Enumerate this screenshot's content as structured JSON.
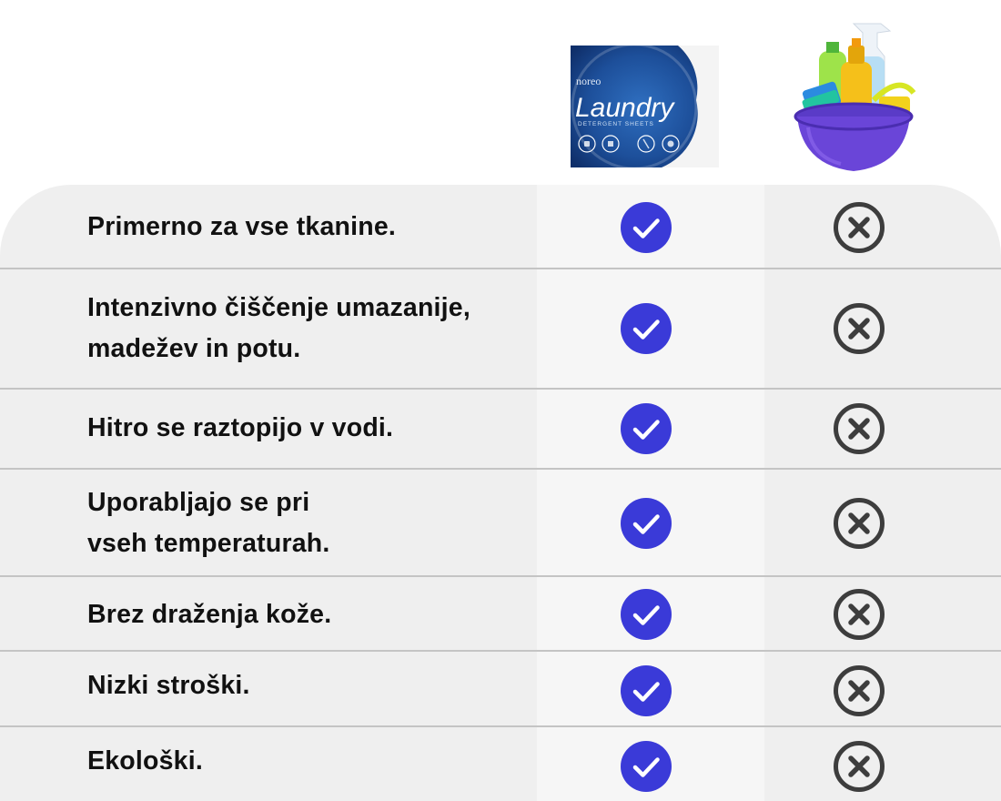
{
  "header": {
    "product_a": {
      "icon": "laundry-sheets-package-image",
      "brand": "noreo",
      "name": "Laundry",
      "subtitle": "DETERGENT SHEETS"
    },
    "product_b": {
      "icon": "cleaning-products-bucket-image"
    }
  },
  "colors": {
    "check_circle": "#3a3ad8",
    "cross_ring": "#3d3d3d",
    "table_bg": "#efefef",
    "divider": "#c4c4c4"
  },
  "rows": [
    {
      "label": "Primerno za vse tkanine.",
      "product_a": "check-icon",
      "product_b": "cross-icon"
    },
    {
      "label": "Intenzivno čiščenje umazanije,\nmadežev in potu.",
      "product_a": "check-icon",
      "product_b": "cross-icon"
    },
    {
      "label": "Hitro se raztopijo v vodi.",
      "product_a": "check-icon",
      "product_b": "cross-icon"
    },
    {
      "label": "Uporabljajo se pri\nvseh temperaturah.",
      "product_a": "check-icon",
      "product_b": "cross-icon"
    },
    {
      "label": "Brez draženja kože.",
      "product_a": "check-icon",
      "product_b": "cross-icon"
    },
    {
      "label": "Nizki stroški.",
      "product_a": "check-icon",
      "product_b": "cross-icon"
    },
    {
      "label": "Ekološki.",
      "product_a": "check-icon",
      "product_b": "cross-icon"
    }
  ]
}
